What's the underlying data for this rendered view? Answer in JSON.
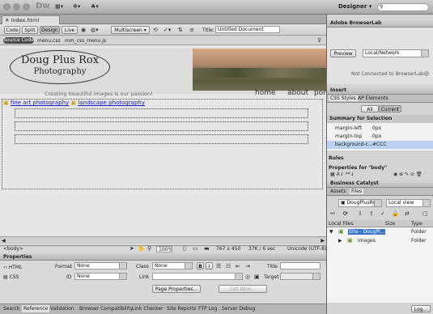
{
  "app": {
    "logo": "Dw",
    "workspace": "Designer",
    "search_icon": "search-icon"
  },
  "doc": {
    "tab": "index.html (XHTML)"
  },
  "toolbar": {
    "code": "Code",
    "split": "Split",
    "design": "Design",
    "live": "Live",
    "multiscreen": "Multiscreen",
    "title_label": "Title:",
    "title_value": "Untitled Document"
  },
  "related": {
    "source": "Source Code",
    "files": [
      "menu.css",
      "mm_css_menu.js"
    ]
  },
  "page": {
    "logo_line1": "Doug Plus Rox",
    "logo_line2": "Photography",
    "tagline": "Creating beautiful images is our passion!",
    "nav": [
      "home",
      "about",
      "por"
    ],
    "links": [
      "fine art photography",
      "landscape photography"
    ]
  },
  "status": {
    "tag": "<body>",
    "zoom": "100%",
    "size": "767 x 450",
    "weight": "37K / 6 sec",
    "encoding": "Unicode (UTF-8)"
  },
  "props": {
    "title": "Properties",
    "html": "HTML",
    "css": "CSS",
    "format_label": "Format",
    "format_value": "None",
    "class_label": "Class",
    "class_value": "None",
    "id_label": "ID",
    "id_value": "None",
    "link_label": "Link",
    "title_label": "Title",
    "target_label": "Target",
    "page_props": "Page Properties...",
    "list_item": "List Item..."
  },
  "bottom_tabs": [
    "Search",
    "Reference",
    "Validation",
    "Browser Compatibility",
    "Link Checker",
    "Site Reports",
    "FTP Log",
    "Server Debug"
  ],
  "browserlab": {
    "title": "Adobe BrowserLab",
    "preview": "Preview",
    "mode": "Local/Network",
    "status": "Not Connected to BrowserLab"
  },
  "insert": {
    "title": "Insert"
  },
  "css_panel": {
    "tab1": "CSS Styles",
    "tab2": "AP Elements",
    "all": "All",
    "current": "Current",
    "summary": "Summary for Selection",
    "rules": [
      {
        "p": "margin-left",
        "v": "0px"
      },
      {
        "p": "margin-top",
        "v": "0px"
      },
      {
        "p": "background-c...",
        "v": "#CCC"
      }
    ],
    "rules_label": "Rules",
    "props_for": "Properties for \"body\""
  },
  "bc": {
    "title": "Business Catalyst"
  },
  "files": {
    "tab1": "Assets",
    "tab2": "Files",
    "site": "DougPlusRox",
    "view": "Local view",
    "col_local": "Local Files",
    "col_size": "Size",
    "col_type": "Type",
    "rows": [
      {
        "name": "Site - DougPl...",
        "type": "Folder"
      },
      {
        "name": "images",
        "type": "Folder"
      }
    ],
    "log": "Log..."
  }
}
